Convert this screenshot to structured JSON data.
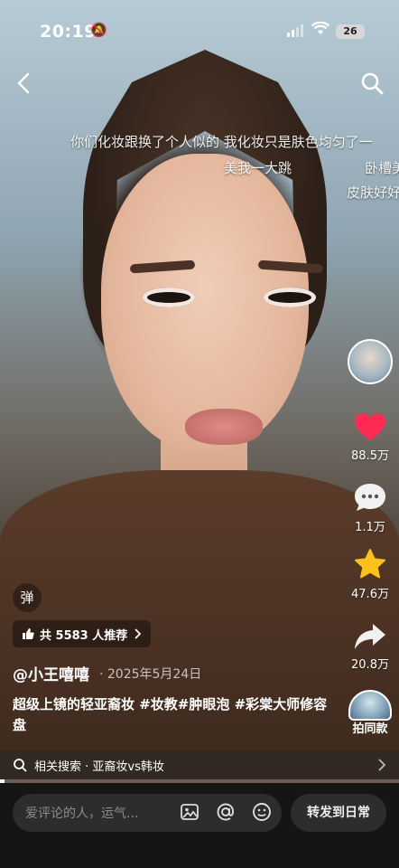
{
  "status_bar": {
    "time": "20:19",
    "battery": "26"
  },
  "danmu": [
    "你们化妆跟换了个人似的 我化妆只是肤色均匀了一",
    "美我一大跳",
    "卧槽美",
    "皮肤好好"
  ],
  "actions": {
    "likes": "88.5万",
    "comments": "1.1万",
    "favorites": "47.6万",
    "shares": "20.8万",
    "same_style_label": "拍同款"
  },
  "danmu_toggle": "弹",
  "recommend": "共 5583 人推荐",
  "author": "@小王嘻嘻",
  "date": "· 2025年5月24日",
  "caption": "超级上镜的轻亚裔妆 #妆教#肿眼泡 #彩棠大师修容盘",
  "related_search": "相关搜索 · 亚裔妆vs韩妆",
  "progress": 0.01,
  "bottom": {
    "comment_placeholder": "爱评论的人，运气...",
    "forward_label": "转发到日常"
  },
  "colors": {
    "like": "#fe2c55",
    "favorite": "#fcc11d"
  }
}
